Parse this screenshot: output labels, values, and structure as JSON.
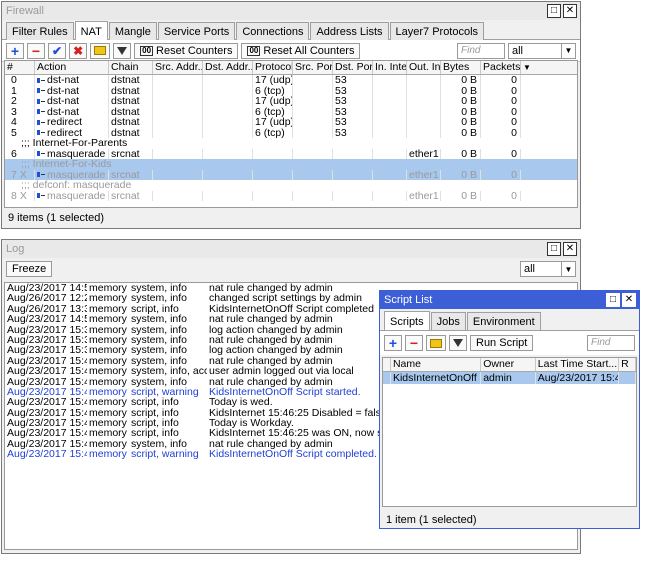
{
  "firewall": {
    "title": "Firewall",
    "tabs": [
      "Filter Rules",
      "NAT",
      "Mangle",
      "Service Ports",
      "Connections",
      "Address Lists",
      "Layer7 Protocols"
    ],
    "active_tab": 1,
    "toolbar": {
      "reset_counters": "Reset Counters",
      "reset_all_counters": "Reset All Counters",
      "find_placeholder": "Find",
      "filter_value": "all"
    },
    "columns": [
      "#",
      "Action",
      "Chain",
      "Src. Address",
      "Dst. Address",
      "Protocol",
      "Src. Port",
      "Dst. Port",
      "In. Inter...",
      "Out. In...",
      "Bytes",
      "Packets"
    ],
    "header_labels": [
      "#",
      "Action",
      "Chain",
      "Src. Addr...",
      "Dst. Addr...",
      "Protocol",
      "Src. Port",
      "Dst. Port",
      "In. Inte...",
      "Out. Int...",
      "Bytes",
      "Packets"
    ],
    "rows": [
      {
        "type": "rule",
        "num": "0",
        "flags": "",
        "action": "dst-nat",
        "chain": "dstnat",
        "src": "",
        "dst": "",
        "proto": "17 (udp)",
        "sport": "",
        "dport": "53",
        "in": "",
        "out": "",
        "bytes": "0 B",
        "packets": "0"
      },
      {
        "type": "rule",
        "num": "1",
        "flags": "",
        "action": "dst-nat",
        "chain": "dstnat",
        "src": "",
        "dst": "",
        "proto": "6 (tcp)",
        "sport": "",
        "dport": "53",
        "in": "",
        "out": "",
        "bytes": "0 B",
        "packets": "0"
      },
      {
        "type": "rule",
        "num": "2",
        "flags": "",
        "action": "dst-nat",
        "chain": "dstnat",
        "src": "",
        "dst": "",
        "proto": "17 (udp)",
        "sport": "",
        "dport": "53",
        "in": "",
        "out": "",
        "bytes": "0 B",
        "packets": "0"
      },
      {
        "type": "rule",
        "num": "3",
        "flags": "",
        "action": "dst-nat",
        "chain": "dstnat",
        "src": "",
        "dst": "",
        "proto": "6 (tcp)",
        "sport": "",
        "dport": "53",
        "in": "",
        "out": "",
        "bytes": "0 B",
        "packets": "0"
      },
      {
        "type": "rule",
        "num": "4",
        "flags": "",
        "action": "redirect",
        "chain": "dstnat",
        "src": "",
        "dst": "",
        "proto": "17 (udp)",
        "sport": "",
        "dport": "53",
        "in": "",
        "out": "",
        "bytes": "0 B",
        "packets": "0"
      },
      {
        "type": "rule",
        "num": "5",
        "flags": "",
        "action": "redirect",
        "chain": "dstnat",
        "src": "",
        "dst": "",
        "proto": "6 (tcp)",
        "sport": "",
        "dport": "53",
        "in": "",
        "out": "",
        "bytes": "0 B",
        "packets": "0"
      },
      {
        "type": "comment",
        "text": ";;; Internet-For-Parents",
        "selected": false,
        "disabled": false
      },
      {
        "type": "rule",
        "num": "6",
        "flags": "",
        "action": "masquerade",
        "chain": "srcnat",
        "src": "",
        "dst": "",
        "proto": "",
        "sport": "",
        "dport": "",
        "in": "",
        "out": "ether1",
        "bytes": "0 B",
        "packets": "0"
      },
      {
        "type": "comment",
        "text": ";;; Internet-For-Kids",
        "selected": true,
        "disabled": true
      },
      {
        "type": "rule",
        "num": "7",
        "flags": "X",
        "action": "masquerade",
        "chain": "srcnat",
        "src": "",
        "dst": "",
        "proto": "",
        "sport": "",
        "dport": "",
        "in": "",
        "out": "ether1",
        "bytes": "0 B",
        "packets": "0",
        "selected": true,
        "disabled": true
      },
      {
        "type": "comment",
        "text": ";;; defconf: masquerade",
        "selected": false,
        "disabled": true
      },
      {
        "type": "rule",
        "num": "8",
        "flags": "X",
        "action": "masquerade",
        "chain": "srcnat",
        "src": "",
        "dst": "",
        "proto": "",
        "sport": "",
        "dport": "",
        "in": "",
        "out": "ether1",
        "bytes": "0 B",
        "packets": "0",
        "disabled": true
      }
    ],
    "status": "9 items (1 selected)"
  },
  "log": {
    "title": "Log",
    "freeze": "Freeze",
    "filter_value": "all",
    "rows": [
      {
        "time": "Aug/23/2017 14:50...",
        "buffer": "memory",
        "topics": "system, info",
        "message": "nat rule changed by admin",
        "blue": false
      },
      {
        "time": "Aug/26/2017 12:29...",
        "buffer": "memory",
        "topics": "system, info",
        "message": "changed script settings by admin",
        "blue": false
      },
      {
        "time": "Aug/26/2017 13:34...",
        "buffer": "memory",
        "topics": "script, info",
        "message": "KidsInternetOnOff Script completed",
        "blue": false
      },
      {
        "time": "Aug/23/2017 14:50...",
        "buffer": "memory",
        "topics": "system, info",
        "message": "nat rule changed by admin",
        "blue": false
      },
      {
        "time": "Aug/23/2017 15:31...",
        "buffer": "memory",
        "topics": "system, info",
        "message": "log action changed by admin",
        "blue": false
      },
      {
        "time": "Aug/23/2017 15:31...",
        "buffer": "memory",
        "topics": "system, info",
        "message": "nat rule changed by admin",
        "blue": false
      },
      {
        "time": "Aug/23/2017 15:31...",
        "buffer": "memory",
        "topics": "system, info",
        "message": "log action changed by admin",
        "blue": false
      },
      {
        "time": "Aug/23/2017 15:45...",
        "buffer": "memory",
        "topics": "system, info",
        "message": "nat rule changed by admin",
        "blue": false
      },
      {
        "time": "Aug/23/2017 15:45...",
        "buffer": "memory",
        "topics": "system, info, acc...",
        "message": "user admin logged out via local",
        "blue": false
      },
      {
        "time": "Aug/23/2017 15:45...",
        "buffer": "memory",
        "topics": "system, info",
        "message": "nat rule changed by admin",
        "blue": false
      },
      {
        "time": "Aug/23/2017 15:46...",
        "buffer": "memory",
        "topics": "script, warning",
        "message": "KidsInternetOnOff Script started.",
        "blue": true
      },
      {
        "time": "Aug/23/2017 15:46...",
        "buffer": "memory",
        "topics": "script, info",
        "message": "Today is wed.",
        "blue": false
      },
      {
        "time": "Aug/23/2017 15:46...",
        "buffer": "memory",
        "topics": "script, info",
        "message": "KidsInternet 15:46:25 Disabled = false",
        "blue": false
      },
      {
        "time": "Aug/23/2017 15:46...",
        "buffer": "memory",
        "topics": "script, info",
        "message": "Today is Workday.",
        "blue": false
      },
      {
        "time": "Aug/23/2017 15:46...",
        "buffer": "memory",
        "topics": "script, info",
        "message": "KidsInternet 15:46:25 was ON, now switchin",
        "blue": false
      },
      {
        "time": "Aug/23/2017 15:46...",
        "buffer": "memory",
        "topics": "system, info",
        "message": "nat rule changed by admin",
        "blue": false
      },
      {
        "time": "Aug/23/2017 15:46...",
        "buffer": "memory",
        "topics": "script, warning",
        "message": "KidsInternetOnOff Script completed.",
        "blue": true
      }
    ]
  },
  "script_list": {
    "title": "Script List",
    "tabs": [
      "Scripts",
      "Jobs",
      "Environment"
    ],
    "active_tab": 0,
    "run_script": "Run Script",
    "find_placeholder": "Find",
    "columns": [
      "Name",
      "Owner",
      "Last Time Start...",
      "R"
    ],
    "rows": [
      {
        "name": "KidsInternetOnOff",
        "owner": "admin",
        "last_started": "Aug/23/2017 15:4...",
        "selected": true
      }
    ],
    "status": "1 item (1 selected)"
  },
  "colors": {
    "active_title": "#3c5ed6",
    "selection": "#a8c8ee",
    "warning_text": "#1f3fd6"
  }
}
